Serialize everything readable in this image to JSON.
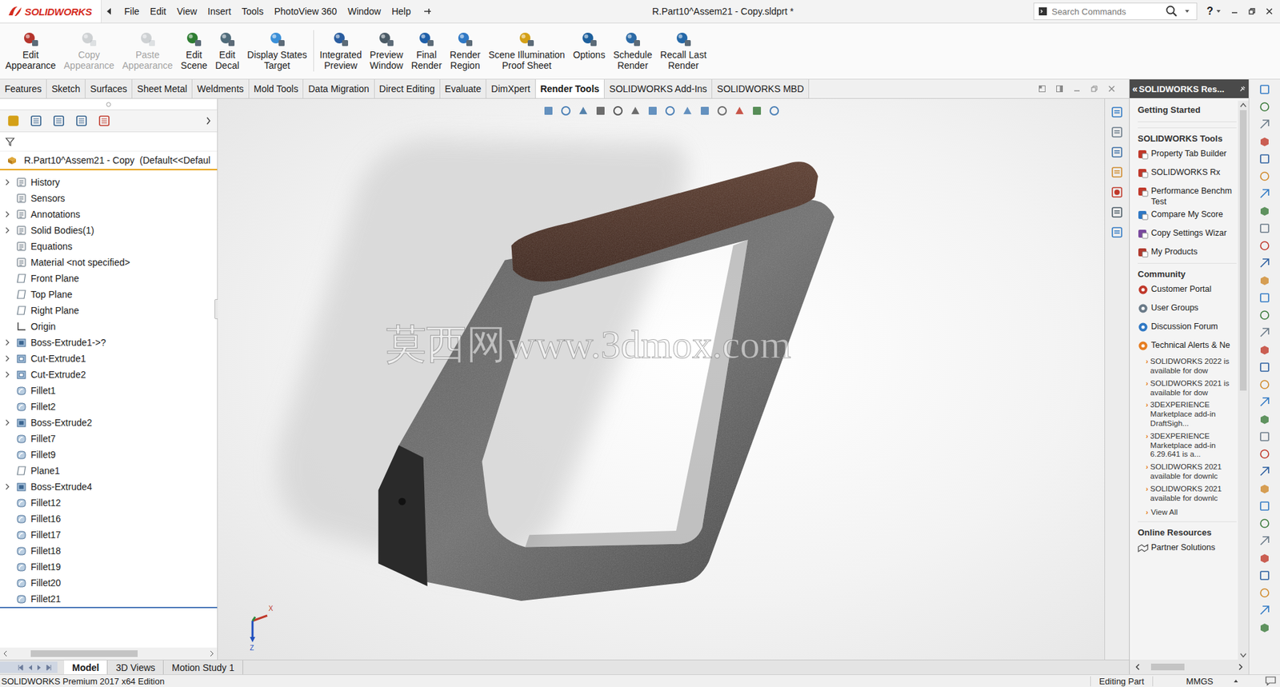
{
  "app": {
    "logo": "SOLIDWORKS",
    "title": "R.Part10^Assem21 - Copy.sldprt *",
    "help": "?"
  },
  "menu": [
    "File",
    "Edit",
    "View",
    "Insert",
    "Tools",
    "PhotoView 360",
    "Window",
    "Help"
  ],
  "search": {
    "placeholder": "Search Commands"
  },
  "ribbon_groups": [
    {
      "buttons": [
        {
          "lines": [
            "Edit",
            "Appearance"
          ],
          "disabled": false
        },
        {
          "lines": [
            "Copy",
            "Appearance"
          ],
          "disabled": true
        },
        {
          "lines": [
            "Paste",
            "Appearance"
          ],
          "disabled": true
        },
        {
          "lines": [
            "Edit",
            "Scene"
          ],
          "disabled": false
        },
        {
          "lines": [
            "Edit",
            "Decal"
          ],
          "disabled": false
        },
        {
          "lines": [
            "Display States",
            "Target"
          ],
          "disabled": false
        }
      ]
    },
    {
      "buttons": [
        {
          "lines": [
            "Integrated",
            "Preview"
          ],
          "disabled": false
        },
        {
          "lines": [
            "Preview",
            "Window"
          ],
          "disabled": false
        },
        {
          "lines": [
            "Final",
            "Render"
          ],
          "disabled": false
        },
        {
          "lines": [
            "Render",
            "Region"
          ],
          "disabled": false
        },
        {
          "lines": [
            "Scene Illumination",
            "Proof Sheet"
          ],
          "disabled": false
        },
        {
          "lines": [
            "Options"
          ],
          "disabled": false
        },
        {
          "lines": [
            "Schedule",
            "Render"
          ],
          "disabled": false
        },
        {
          "lines": [
            "Recall Last",
            "Render"
          ],
          "disabled": false
        }
      ]
    }
  ],
  "command_tabs": [
    {
      "label": "Features",
      "selected": false
    },
    {
      "label": "Sketch",
      "selected": false
    },
    {
      "label": "Surfaces",
      "selected": false
    },
    {
      "label": "Sheet Metal",
      "selected": false
    },
    {
      "label": "Weldments",
      "selected": false
    },
    {
      "label": "Mold Tools",
      "selected": false
    },
    {
      "label": "Data Migration",
      "selected": false
    },
    {
      "label": "Direct Editing",
      "selected": false
    },
    {
      "label": "Evaluate",
      "selected": false
    },
    {
      "label": "DimXpert",
      "selected": false
    },
    {
      "label": "Render Tools",
      "selected": true
    },
    {
      "label": "SOLIDWORKS Add-Ins",
      "selected": false
    },
    {
      "label": "SOLIDWORKS MBD",
      "selected": false
    }
  ],
  "feature_tree": {
    "root": "R.Part10^Assem21 - Copy  (Default<<Defaul",
    "items": [
      {
        "label": "History",
        "kind": "history",
        "expandable": true
      },
      {
        "label": "Sensors",
        "kind": "sensors",
        "expandable": false
      },
      {
        "label": "Annotations",
        "kind": "annotations",
        "expandable": true
      },
      {
        "label": "Solid Bodies(1)",
        "kind": "bodies",
        "expandable": true
      },
      {
        "label": "Equations",
        "kind": "equations",
        "expandable": false
      },
      {
        "label": "Material <not specified>",
        "kind": "material",
        "expandable": false
      },
      {
        "label": "Front Plane",
        "kind": "plane",
        "expandable": false
      },
      {
        "label": "Top Plane",
        "kind": "plane",
        "expandable": false
      },
      {
        "label": "Right Plane",
        "kind": "plane",
        "expandable": false
      },
      {
        "label": "Origin",
        "kind": "origin",
        "expandable": false
      },
      {
        "label": "Boss-Extrude1->?",
        "kind": "boss",
        "expandable": true
      },
      {
        "label": "Cut-Extrude1",
        "kind": "cut",
        "expandable": true
      },
      {
        "label": "Cut-Extrude2",
        "kind": "cut",
        "expandable": true
      },
      {
        "label": "Fillet1",
        "kind": "fillet",
        "expandable": false
      },
      {
        "label": "Fillet2",
        "kind": "fillet",
        "expandable": false
      },
      {
        "label": "Boss-Extrude2",
        "kind": "boss",
        "expandable": true
      },
      {
        "label": "Fillet7",
        "kind": "fillet",
        "expandable": false
      },
      {
        "label": "Fillet9",
        "kind": "fillet",
        "expandable": false
      },
      {
        "label": "Plane1",
        "kind": "plane",
        "expandable": false
      },
      {
        "label": "Boss-Extrude4",
        "kind": "boss",
        "expandable": true
      },
      {
        "label": "Fillet12",
        "kind": "fillet",
        "expandable": false
      },
      {
        "label": "Fillet16",
        "kind": "fillet",
        "expandable": false
      },
      {
        "label": "Fillet17",
        "kind": "fillet",
        "expandable": false
      },
      {
        "label": "Fillet18",
        "kind": "fillet",
        "expandable": false
      },
      {
        "label": "Fillet19",
        "kind": "fillet",
        "expandable": false
      },
      {
        "label": "Fillet20",
        "kind": "fillet",
        "expandable": false
      },
      {
        "label": "Fillet21",
        "kind": "fillet",
        "expandable": false
      }
    ]
  },
  "viewport": {
    "watermark": "莫西网www.3dmox.com",
    "triad": {
      "x": "X",
      "z": "Z"
    }
  },
  "task_pane": {
    "collapse": "«",
    "title": "SOLIDWORKS Res...",
    "header": "Getting Started",
    "tools": {
      "title": "SOLIDWORKS Tools",
      "items": [
        "Property Tab Builder",
        "SOLIDWORKS Rx",
        "Performance Benchm Test",
        "Compare My Score",
        "Copy Settings Wizar",
        "My Products"
      ]
    },
    "community": {
      "title": "Community",
      "items": [
        "Customer Portal",
        "User Groups",
        "Discussion Forum",
        "Technical Alerts & Ne"
      ],
      "bullet": "›",
      "news": [
        "SOLIDWORKS 2022 is available for dow",
        "SOLIDWORKS 2021 is available for dow",
        "3DEXPERIENCE Marketplace add-in DraftSigh...",
        "3DEXPERIENCE Marketplace add-in 6.29.641 is a...",
        "SOLIDWORKS 2021 available for downlc",
        "SOLIDWORKS 2021 available for downlc"
      ],
      "more": "View All"
    },
    "online": {
      "title": "Online Resources",
      "items": [
        "Partner Solutions"
      ]
    }
  },
  "bottom_tabs": [
    {
      "label": "Model",
      "selected": true
    },
    {
      "label": "3D Views",
      "selected": false
    },
    {
      "label": "Motion Study 1",
      "selected": false
    }
  ],
  "status_bar": {
    "edition": "SOLIDWORKS Premium 2017 x64 Edition",
    "mode": "Editing Part",
    "units": "MMGS"
  }
}
